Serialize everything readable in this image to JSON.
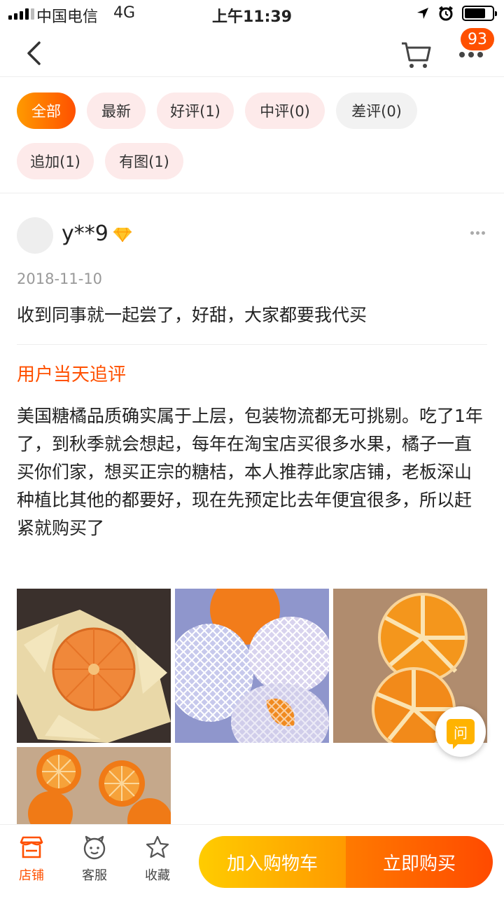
{
  "status_bar": {
    "carrier": "中国电信",
    "network": "4G",
    "time": "上午11:39",
    "battery_level": 0.75
  },
  "nav": {
    "back_icon": "chevron-left-icon",
    "cart_icon": "cart-icon",
    "more_icon": "more-dots-icon",
    "badge_count": "93"
  },
  "filters": [
    {
      "label": "全部",
      "active": true
    },
    {
      "label": "最新"
    },
    {
      "label": "好评(1)"
    },
    {
      "label": "中评(0)"
    },
    {
      "label": "差评(0)"
    },
    {
      "label": "追加(1)"
    },
    {
      "label": "有图(1)"
    }
  ],
  "review": {
    "user_name": "y**9",
    "vip_icon": "diamond-icon",
    "date": "2018-11-10",
    "text": "收到同事就一起尝了，好甜，大家都要我代买",
    "append_title": "用户当天追评",
    "append_text": "美国糖橘品质确实属于上层，包装物流都无可挑剔。吃了1年了，到秋季就会想起，每年在淘宝店买很多水果，橘子一直买你们家，想买正宗的糖桔，本人推荐此家店铺，老板深山种植比其他的都要好，现在先预定比去年便宜很多，所以赶紧就购买了",
    "photos": [
      "peeled-orange-photo",
      "oranges-in-foam-net-photo",
      "orange-segments-photo",
      "halved-oranges-photo"
    ]
  },
  "ask_button": {
    "label": "问"
  },
  "bottom_bar": {
    "tabs": [
      {
        "label": "店铺",
        "icon": "store-icon"
      },
      {
        "label": "客服",
        "icon": "service-icon"
      },
      {
        "label": "收藏",
        "icon": "star-icon"
      }
    ],
    "add_to_cart": "加入购物车",
    "buy_now": "立即购买"
  },
  "colors": {
    "accent": "#ff5000",
    "accent_light": "#ff9a00",
    "chip_bg": "#fdeaea",
    "chip_grey": "#f2f2f2"
  }
}
